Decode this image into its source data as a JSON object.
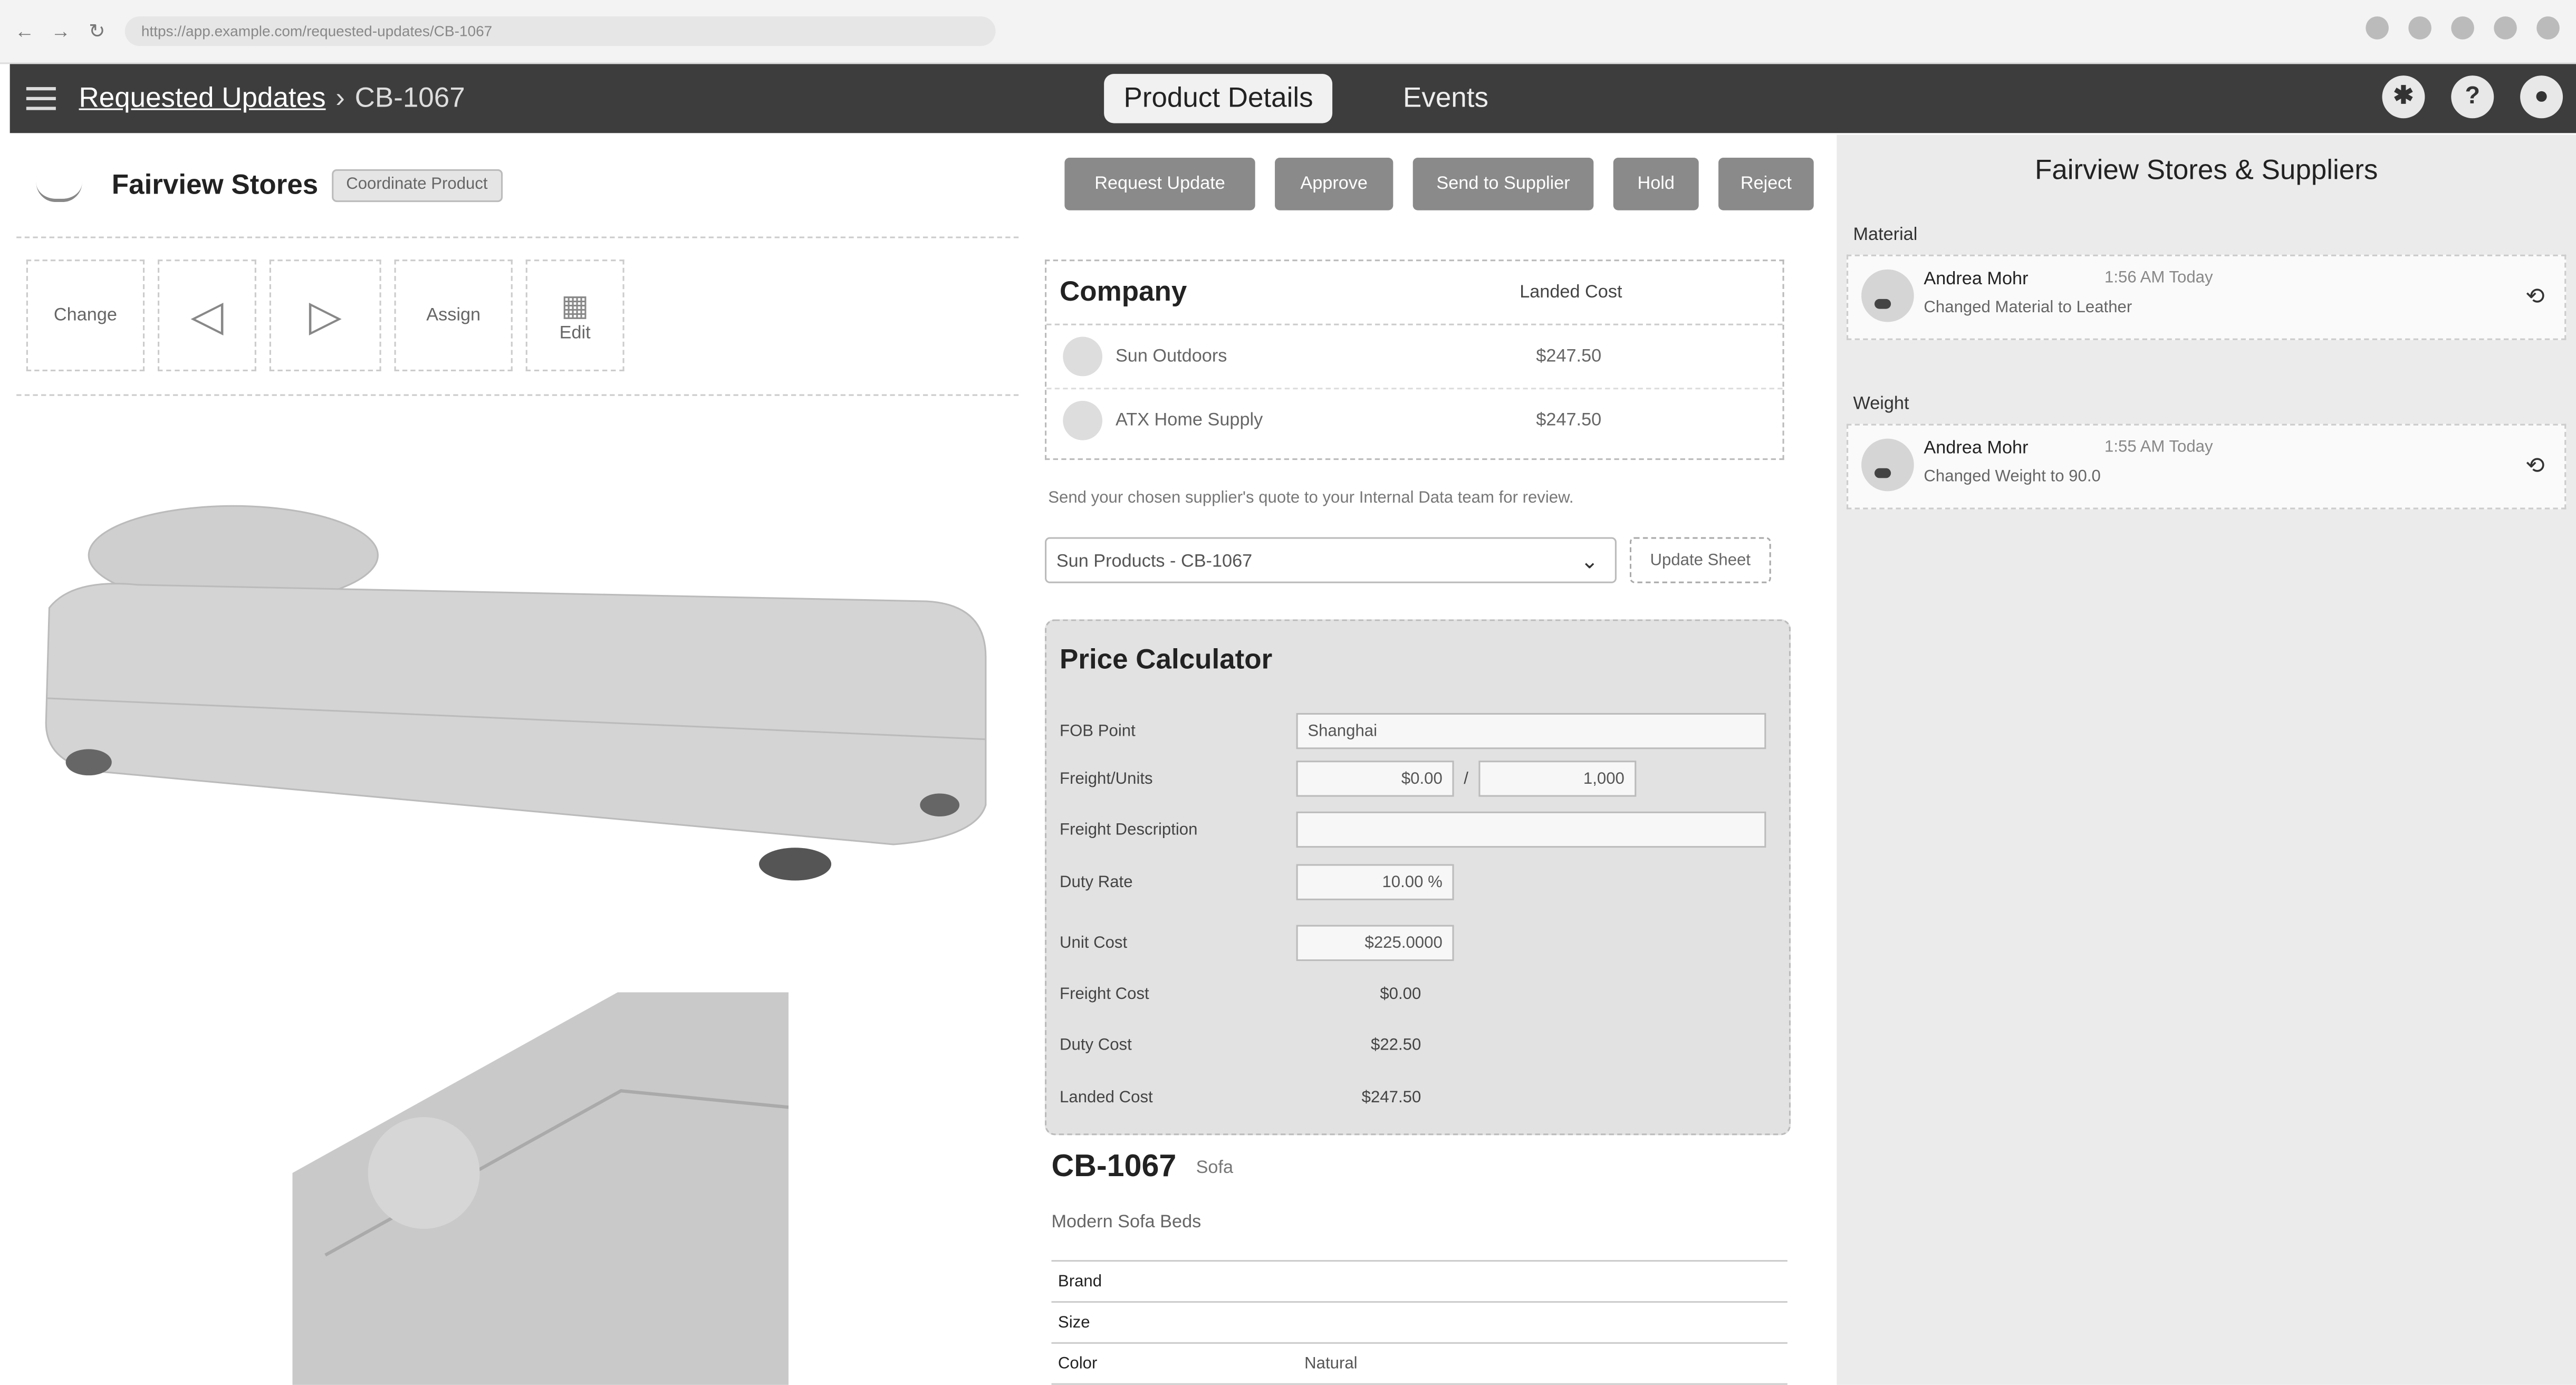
{
  "browser": {
    "url": "https://app.example.com/requested-updates/CB-1067"
  },
  "header": {
    "breadcrumb_link": "Requested Updates",
    "breadcrumb_sep": "›",
    "breadcrumb_current": "CB-1067",
    "tabs": [
      {
        "label": "Product Details",
        "active": true
      },
      {
        "label": "Events",
        "active": false
      }
    ],
    "help_label": "?"
  },
  "company": {
    "name": "Fairview Stores",
    "badge": "Coordinate Product"
  },
  "toolbar": {
    "items": [
      {
        "label": "Change",
        "icon": "text-tool-icon"
      },
      {
        "label": "",
        "icon": "prev-icon"
      },
      {
        "label": "",
        "icon": "next-icon"
      },
      {
        "label": "Assign",
        "icon": "text-tool-icon"
      },
      {
        "label": "Edit",
        "icon": "grid-icon"
      }
    ]
  },
  "actions": [
    {
      "label": "Request Update"
    },
    {
      "label": "Approve"
    },
    {
      "label": "Send to Supplier"
    },
    {
      "label": "Hold"
    },
    {
      "label": "Reject"
    }
  ],
  "cost_table": {
    "col1": "Company",
    "col2": "Landed Cost",
    "rows": [
      {
        "name": "Sun Outdoors",
        "value": "$247.50"
      },
      {
        "name": "ATX Home Supply",
        "value": "$247.50"
      }
    ]
  },
  "note": "Send your chosen supplier's quote to your Internal Data team for review.",
  "select": {
    "value": "Sun Products - CB-1067"
  },
  "update_button": "Update Sheet",
  "calculator": {
    "title": "Price Calculator",
    "fob_label": "FOB Point",
    "fob_value": "Shanghai",
    "freight_label": "Freight/Units",
    "freight_value": "$0.00",
    "freight_units": "1,000",
    "freight_sep": "/",
    "freight_desc_label": "Freight Description",
    "freight_desc_value": "",
    "duty_rate_label": "Duty Rate",
    "duty_rate_value": "10.00 %",
    "unit_cost_label": "Unit Cost",
    "unit_cost_value": "$225.0000",
    "freight_cost_label": "Freight Cost",
    "freight_cost_value": "$0.00",
    "duty_cost_label": "Duty Cost",
    "duty_cost_value": "$22.50",
    "landed_cost_label": "Landed Cost",
    "landed_cost_value": "$247.50"
  },
  "product": {
    "title": "CB-1067",
    "sub": "Sofa",
    "description": "Modern Sofa Beds",
    "attributes": [
      {
        "key": "Brand",
        "value": ""
      },
      {
        "key": "Size",
        "value": ""
      },
      {
        "key": "Color",
        "value": "Natural"
      }
    ]
  },
  "history": {
    "title": "Fairview Stores & Suppliers",
    "groups": [
      {
        "label": "Material",
        "who": "Andrea Mohr",
        "when": "1:56 AM Today",
        "what": "Changed Material to Leather"
      },
      {
        "label": "Weight",
        "who": "Andrea Mohr",
        "when": "1:55 AM Today",
        "what": "Changed Weight to 90.0"
      }
    ]
  }
}
